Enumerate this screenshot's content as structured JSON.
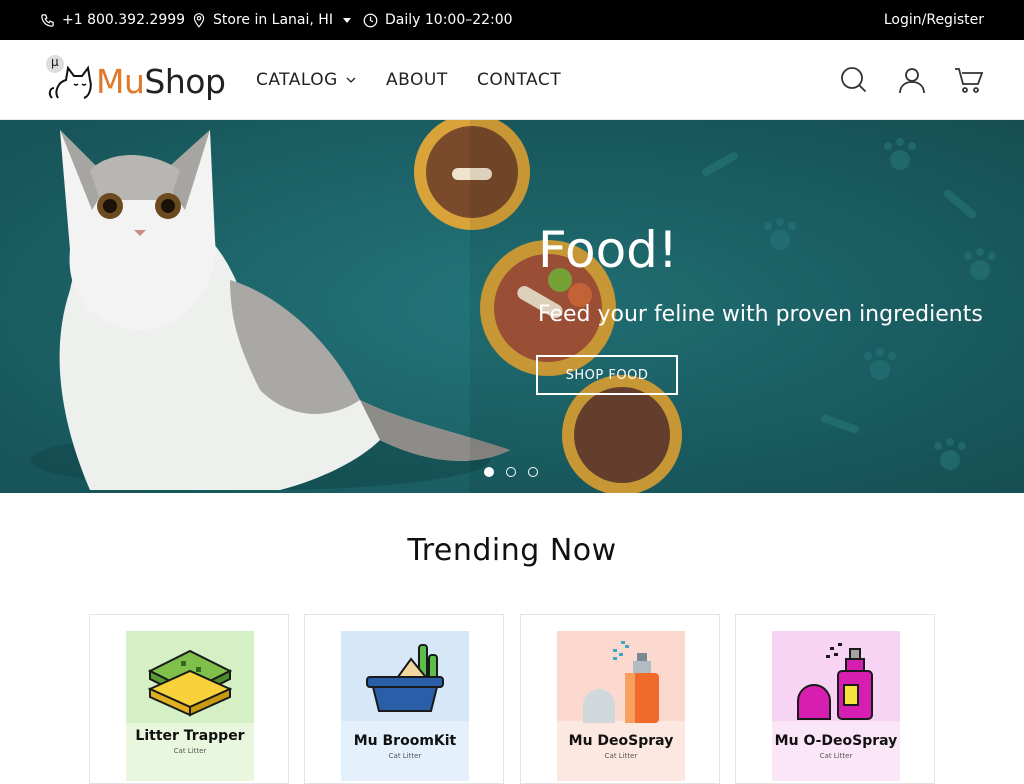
{
  "topbar": {
    "phone": "+1 800.392.2999",
    "store": "Store in Lanai, HI",
    "hours": "Daily 10:00–22:00",
    "login": "Login/Register",
    "icons": [
      "phone-icon",
      "location-pin-icon",
      "clock-icon"
    ]
  },
  "header": {
    "logo_badge": "μ",
    "logo_mu": "Mu",
    "logo_shop": "Shop",
    "nav": {
      "catalog": "CATALOG",
      "about": "ABOUT",
      "contact": "CONTACT"
    },
    "icons": [
      "search-icon",
      "user-icon",
      "cart-icon"
    ]
  },
  "hero": {
    "title": "Food!",
    "subtitle": "Feed your feline with proven ingredients",
    "button": "SHOP FOOD",
    "slides": 3,
    "active_slide": 1
  },
  "trending": {
    "title": "Trending Now",
    "products": [
      {
        "name": "Litter Trapper",
        "category": "Cat Litter",
        "bg": "#d4f0c4"
      },
      {
        "name": "Mu BroomKit",
        "category": "Cat Litter",
        "bg": "#d6e8f8"
      },
      {
        "name": "Mu DeoSpray",
        "category": "Cat Litter",
        "bg": "#fcd9cf"
      },
      {
        "name": "Mu O-DeoSpray",
        "category": "Cat Litter",
        "bg": "#f8d4f4"
      }
    ]
  },
  "colors": {
    "topbar_bg": "#000000",
    "brand_accent": "#e07a2a",
    "hero_bg": "#1f6a6f"
  }
}
